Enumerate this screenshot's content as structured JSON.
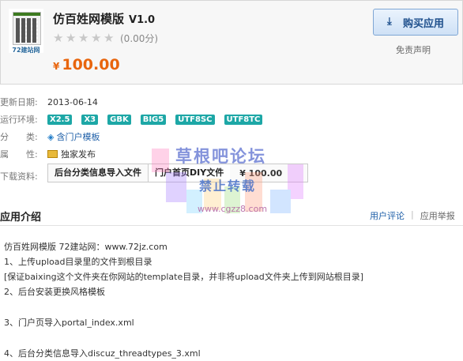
{
  "app": {
    "logo_caption": "72建站网",
    "name": "仿百姓网模版",
    "version": "V1.0",
    "rating_text": "(0.00分)",
    "rating_stars": 0,
    "rating_max": 5,
    "price_symbol": "¥",
    "price": "100.00",
    "buy_label": "购买应用",
    "disclaimer_label": "免责声明"
  },
  "meta": {
    "updated_label": "更新日期:",
    "updated_value": "2013-06-14",
    "env_label": "运行环境:",
    "env_tags": [
      "X2.5",
      "X3",
      "GBK",
      "BIG5",
      "UTF8SC",
      "UTF8TC"
    ],
    "category_label": "分　　类:",
    "category_value": "含门户模板",
    "attr_label": "属　　性:",
    "attr_value": "独家发布",
    "download_label": "下载资料:",
    "download_items": [
      "后台分类信息导入文件",
      "门户首页DIY文件"
    ],
    "download_price": "¥ 100.00"
  },
  "section": {
    "title": "应用介绍",
    "user_reviews": "用户评论",
    "report": "应用举报"
  },
  "description": [
    "仿百姓网模版 72建站网：www.72jz.com",
    "1、上传upload目录里的文件到根目录",
    "[保证baixing这个文件夹在你网站的template目录，并非将upload文件夹上传到网站根目录]",
    "2、后台安装更换风格模板",
    "3、门户页导入portal_index.xml",
    "4、后台分类信息导入discuz_threadtypes_3.xml"
  ],
  "watermark": {
    "line1": "草根吧论坛",
    "line2": "禁止转载",
    "url": "www.cgzz8.com"
  },
  "colors": {
    "price": "#e8650d",
    "tag": "#1da7a6",
    "link": "#1e5fa8",
    "buy_button_text": "#1e4f8c"
  }
}
